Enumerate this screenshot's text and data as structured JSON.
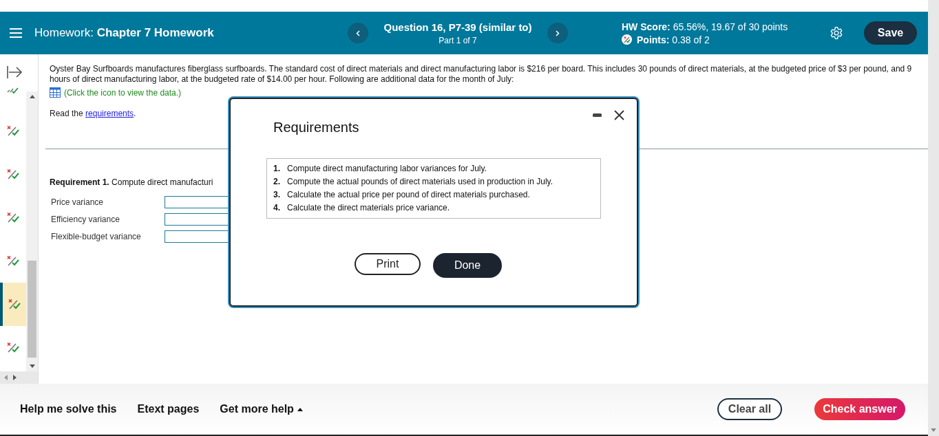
{
  "header": {
    "title_prefix": "Homework:",
    "title": "Chapter 7 Homework",
    "question": "Question 16, P7-39 (similar to)",
    "part": "Part 1 of 7",
    "score_label": "HW Score:",
    "score": "65.56%, 19.67 of 30 points",
    "points_label": "Points:",
    "points": "0.38 of 2",
    "save": "Save"
  },
  "sidebar": {
    "items": [
      {
        "kind": "correct",
        "selected": false
      },
      {
        "kind": "partial",
        "selected": false
      },
      {
        "kind": "partial",
        "selected": false
      },
      {
        "kind": "partial",
        "selected": false
      },
      {
        "kind": "partial",
        "selected": false
      },
      {
        "kind": "partial",
        "selected": true
      },
      {
        "kind": "partial",
        "selected": false
      }
    ]
  },
  "problem": {
    "text": "Oyster Bay Surfboards manufactures fiberglass surfboards. The standard cost of direct materials and direct manufacturing labor is $216 per board. This includes 30 pounds of direct materials, at the budgeted price of $3 per pound, and 9 hours of direct manufacturing labor, at the budgeted rate of $14.00 per hour. Following are additional data for the month of July:",
    "data_link": "(Click the icon to view the data.)",
    "read_prefix": "Read the",
    "read_link": "requirements",
    "read_suffix": "."
  },
  "requirement": {
    "text": "**Requirement 1.** Compute direct manufacturi",
    "fields": [
      {
        "label": "Price variance"
      },
      {
        "label": "Efficiency variance"
      },
      {
        "label": "Flexible-budget variance"
      }
    ]
  },
  "dialog": {
    "title": "Requirements",
    "items": [
      {
        "number": "1.",
        "text": "Compute direct manufacturing labor variances for July."
      },
      {
        "number": "2.",
        "text": "Compute the actual pounds of direct materials used in production in July."
      },
      {
        "number": "3.",
        "text": "Calculate the actual price per pound of direct materials purchased."
      },
      {
        "number": "4.",
        "text": "Calculate the direct materials price variance."
      }
    ],
    "buttons": [
      "Print",
      "Done"
    ]
  },
  "footer": {
    "links": [
      "Help me solve this",
      "Etext pages"
    ],
    "more_help": "Get more help",
    "clear": "Clear all",
    "check": "Check answer"
  }
}
